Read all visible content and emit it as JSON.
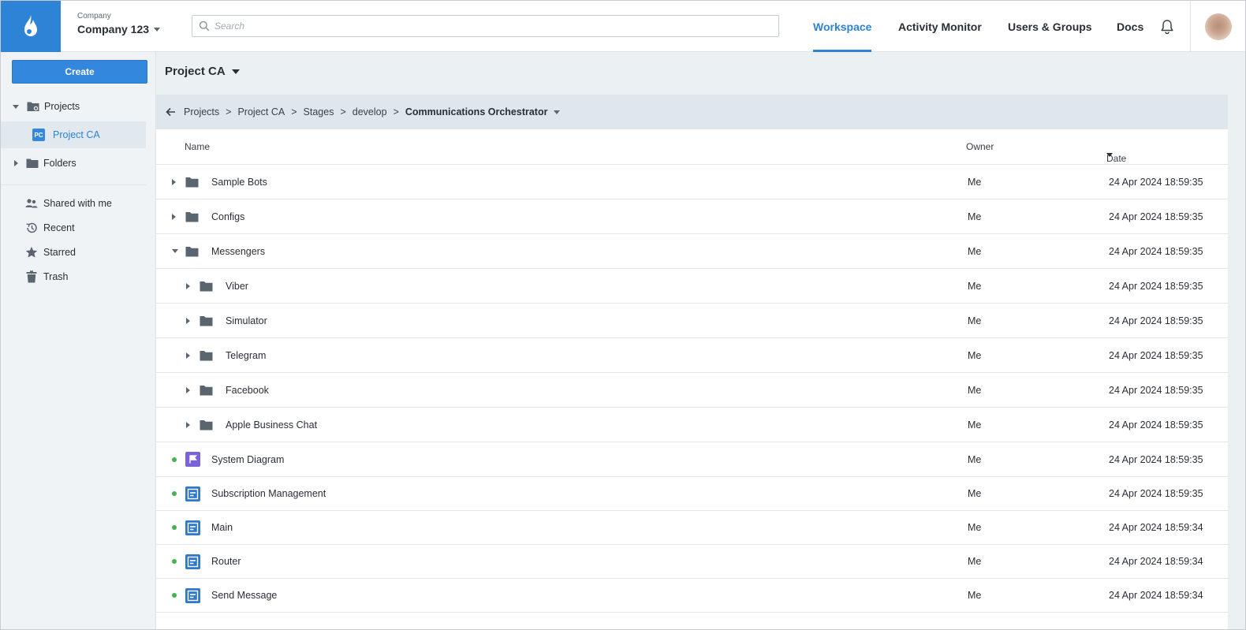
{
  "header": {
    "company_caption": "Company",
    "company_name": "Company 123",
    "search_placeholder": "Search",
    "nav": [
      {
        "label": "Workspace",
        "active": true
      },
      {
        "label": "Activity Monitor",
        "active": false
      },
      {
        "label": "Users & Groups",
        "active": false
      },
      {
        "label": "Docs",
        "active": false
      }
    ]
  },
  "sidebar": {
    "create_label": "Create",
    "tree": {
      "projects": "Projects",
      "project_ca_badge": "PC",
      "project_ca": "Project CA",
      "folders": "Folders"
    },
    "links": {
      "shared": "Shared with me",
      "recent": "Recent",
      "starred": "Starred",
      "trash": "Trash"
    }
  },
  "main": {
    "project_title": "Project CA",
    "breadcrumb": [
      "Projects",
      "Project CA",
      "Stages",
      "develop",
      "Communications Orchestrator"
    ],
    "breadcrumb_separator": ">",
    "columns": {
      "name": "Name",
      "owner": "Owner",
      "date": "Date"
    },
    "rows": [
      {
        "name": "Sample Bots",
        "owner": "Me",
        "date": "24 Apr 2024 18:59:35"
      },
      {
        "name": "Configs",
        "owner": "Me",
        "date": "24 Apr 2024 18:59:35"
      },
      {
        "name": "Messengers",
        "owner": "Me",
        "date": "24 Apr 2024 18:59:35"
      },
      {
        "name": "Viber",
        "owner": "Me",
        "date": "24 Apr 2024 18:59:35"
      },
      {
        "name": "Simulator",
        "owner": "Me",
        "date": "24 Apr 2024 18:59:35"
      },
      {
        "name": "Telegram",
        "owner": "Me",
        "date": "24 Apr 2024 18:59:35"
      },
      {
        "name": "Facebook",
        "owner": "Me",
        "date": "24 Apr 2024 18:59:35"
      },
      {
        "name": "Apple Business Chat",
        "owner": "Me",
        "date": "24 Apr 2024 18:59:35"
      },
      {
        "name": "System Diagram",
        "owner": "Me",
        "date": "24 Apr 2024 18:59:35"
      },
      {
        "name": "Subscription Management",
        "owner": "Me",
        "date": "24 Apr 2024 18:59:35"
      },
      {
        "name": "Main",
        "owner": "Me",
        "date": "24 Apr 2024 18:59:34"
      },
      {
        "name": "Router",
        "owner": "Me",
        "date": "24 Apr 2024 18:59:34"
      },
      {
        "name": "Send Message",
        "owner": "Me",
        "date": "24 Apr 2024 18:59:34"
      }
    ]
  },
  "colors": {
    "accent": "#2d83d6",
    "status_active": "#46b254",
    "folder": "#5a6570",
    "diagram_icon": "#7a62d8",
    "script_icon": "#2f77d0"
  }
}
